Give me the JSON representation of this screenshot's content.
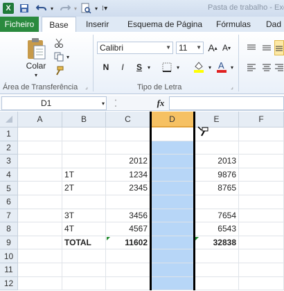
{
  "titlebar": {
    "app_icon": "X",
    "title": "Pasta de trabalho - Excel",
    "icons": [
      "excel-icon",
      "save-icon",
      "undo-icon",
      "redo-icon",
      "print-preview-icon",
      "customize-qat-icon"
    ]
  },
  "tabs": [
    "Ficheiro",
    "Base",
    "Inserir",
    "Esquema de Página",
    "Fórmulas",
    "Dad"
  ],
  "ribbon": {
    "clipboard": {
      "paste_label": "Colar",
      "group_label": "Área de Transferência"
    },
    "font": {
      "font_name": "Calibri",
      "font_size": "11",
      "bold": "N",
      "italic": "I",
      "underline": "S",
      "group_label": "Tipo de Letra"
    }
  },
  "formula_bar": {
    "name_box": "D1",
    "fx": "fx",
    "formula": ""
  },
  "columns": [
    "A",
    "B",
    "C",
    "D",
    "E",
    "F"
  ],
  "rows": [
    "1",
    "2",
    "3",
    "4",
    "5",
    "6",
    "7",
    "8",
    "9",
    "10",
    "11",
    "12"
  ],
  "sheet": {
    "r3": {
      "C": "2012",
      "E": "2013"
    },
    "r4": {
      "B": "1T",
      "C": "1234",
      "E": "9876"
    },
    "r5": {
      "B": "2T",
      "C": "2345",
      "E": "8765"
    },
    "r7": {
      "B": "3T",
      "C": "3456",
      "E": "7654"
    },
    "r8": {
      "B": "4T",
      "C": "4567",
      "E": "6543"
    },
    "r9": {
      "B": "TOTAL",
      "C": "11602",
      "E": "32838"
    }
  },
  "colors": {
    "selection": "#b7d6f7",
    "file_tab": "#2a8a3e",
    "error_triangle": "#1e8a2a"
  }
}
